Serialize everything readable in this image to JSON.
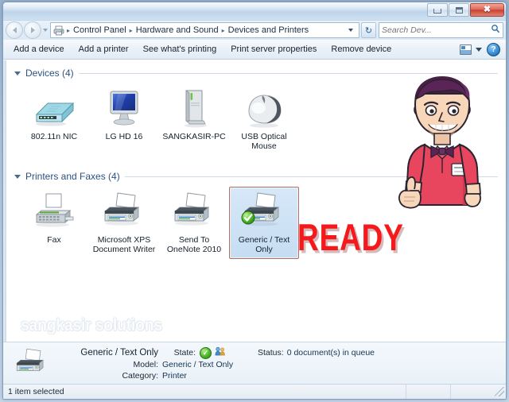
{
  "window": {
    "buttons": {
      "minimize": "minimize",
      "maximize": "maximize",
      "close": "close"
    }
  },
  "address": {
    "breadcrumbs": [
      "Control Panel",
      "Hardware and Sound",
      "Devices and Printers"
    ],
    "separator": "▸",
    "refresh_label": "↻"
  },
  "search": {
    "placeholder": "Search Dev...",
    "value": ""
  },
  "toolbar": {
    "commands": [
      "Add a device",
      "Add a printer",
      "See what's printing",
      "Print server properties",
      "Remove device"
    ],
    "help_label": "?"
  },
  "sections": [
    {
      "title": "Devices (4)",
      "items": [
        {
          "label": "802.11n NIC",
          "icon": "network-adapter-icon"
        },
        {
          "label": "LG HD 16",
          "icon": "monitor-icon"
        },
        {
          "label": "SANGKASIR-PC",
          "icon": "computer-tower-icon"
        },
        {
          "label": "USB Optical Mouse",
          "icon": "mouse-icon"
        }
      ]
    },
    {
      "title": "Printers and Faxes (4)",
      "items": [
        {
          "label": "Fax",
          "icon": "fax-icon",
          "selected": false,
          "default": false
        },
        {
          "label": "Microsoft XPS Document Writer",
          "icon": "printer-icon",
          "selected": false,
          "default": false
        },
        {
          "label": "Send To OneNote 2010",
          "icon": "printer-icon",
          "selected": false,
          "default": false
        },
        {
          "label": "Generic / Text Only",
          "icon": "printer-icon",
          "selected": true,
          "default": true
        }
      ]
    }
  ],
  "overlay": {
    "ready_text": "READY",
    "ready_color": "#f5191b",
    "watermark_text": "sangkasir solutions",
    "mascot": "cartoon-man-thumbs-up"
  },
  "details": {
    "name": "Generic / Text Only",
    "state_label": "State:",
    "state_icons": [
      "default-printer-check-icon",
      "shared-printer-icon"
    ],
    "model_label": "Model:",
    "model_value": "Generic / Text Only",
    "category_label": "Category:",
    "category_value": "Printer",
    "status_label": "Status:",
    "status_value": "0 document(s) in queue"
  },
  "statusbar": {
    "text": "1 item selected"
  }
}
